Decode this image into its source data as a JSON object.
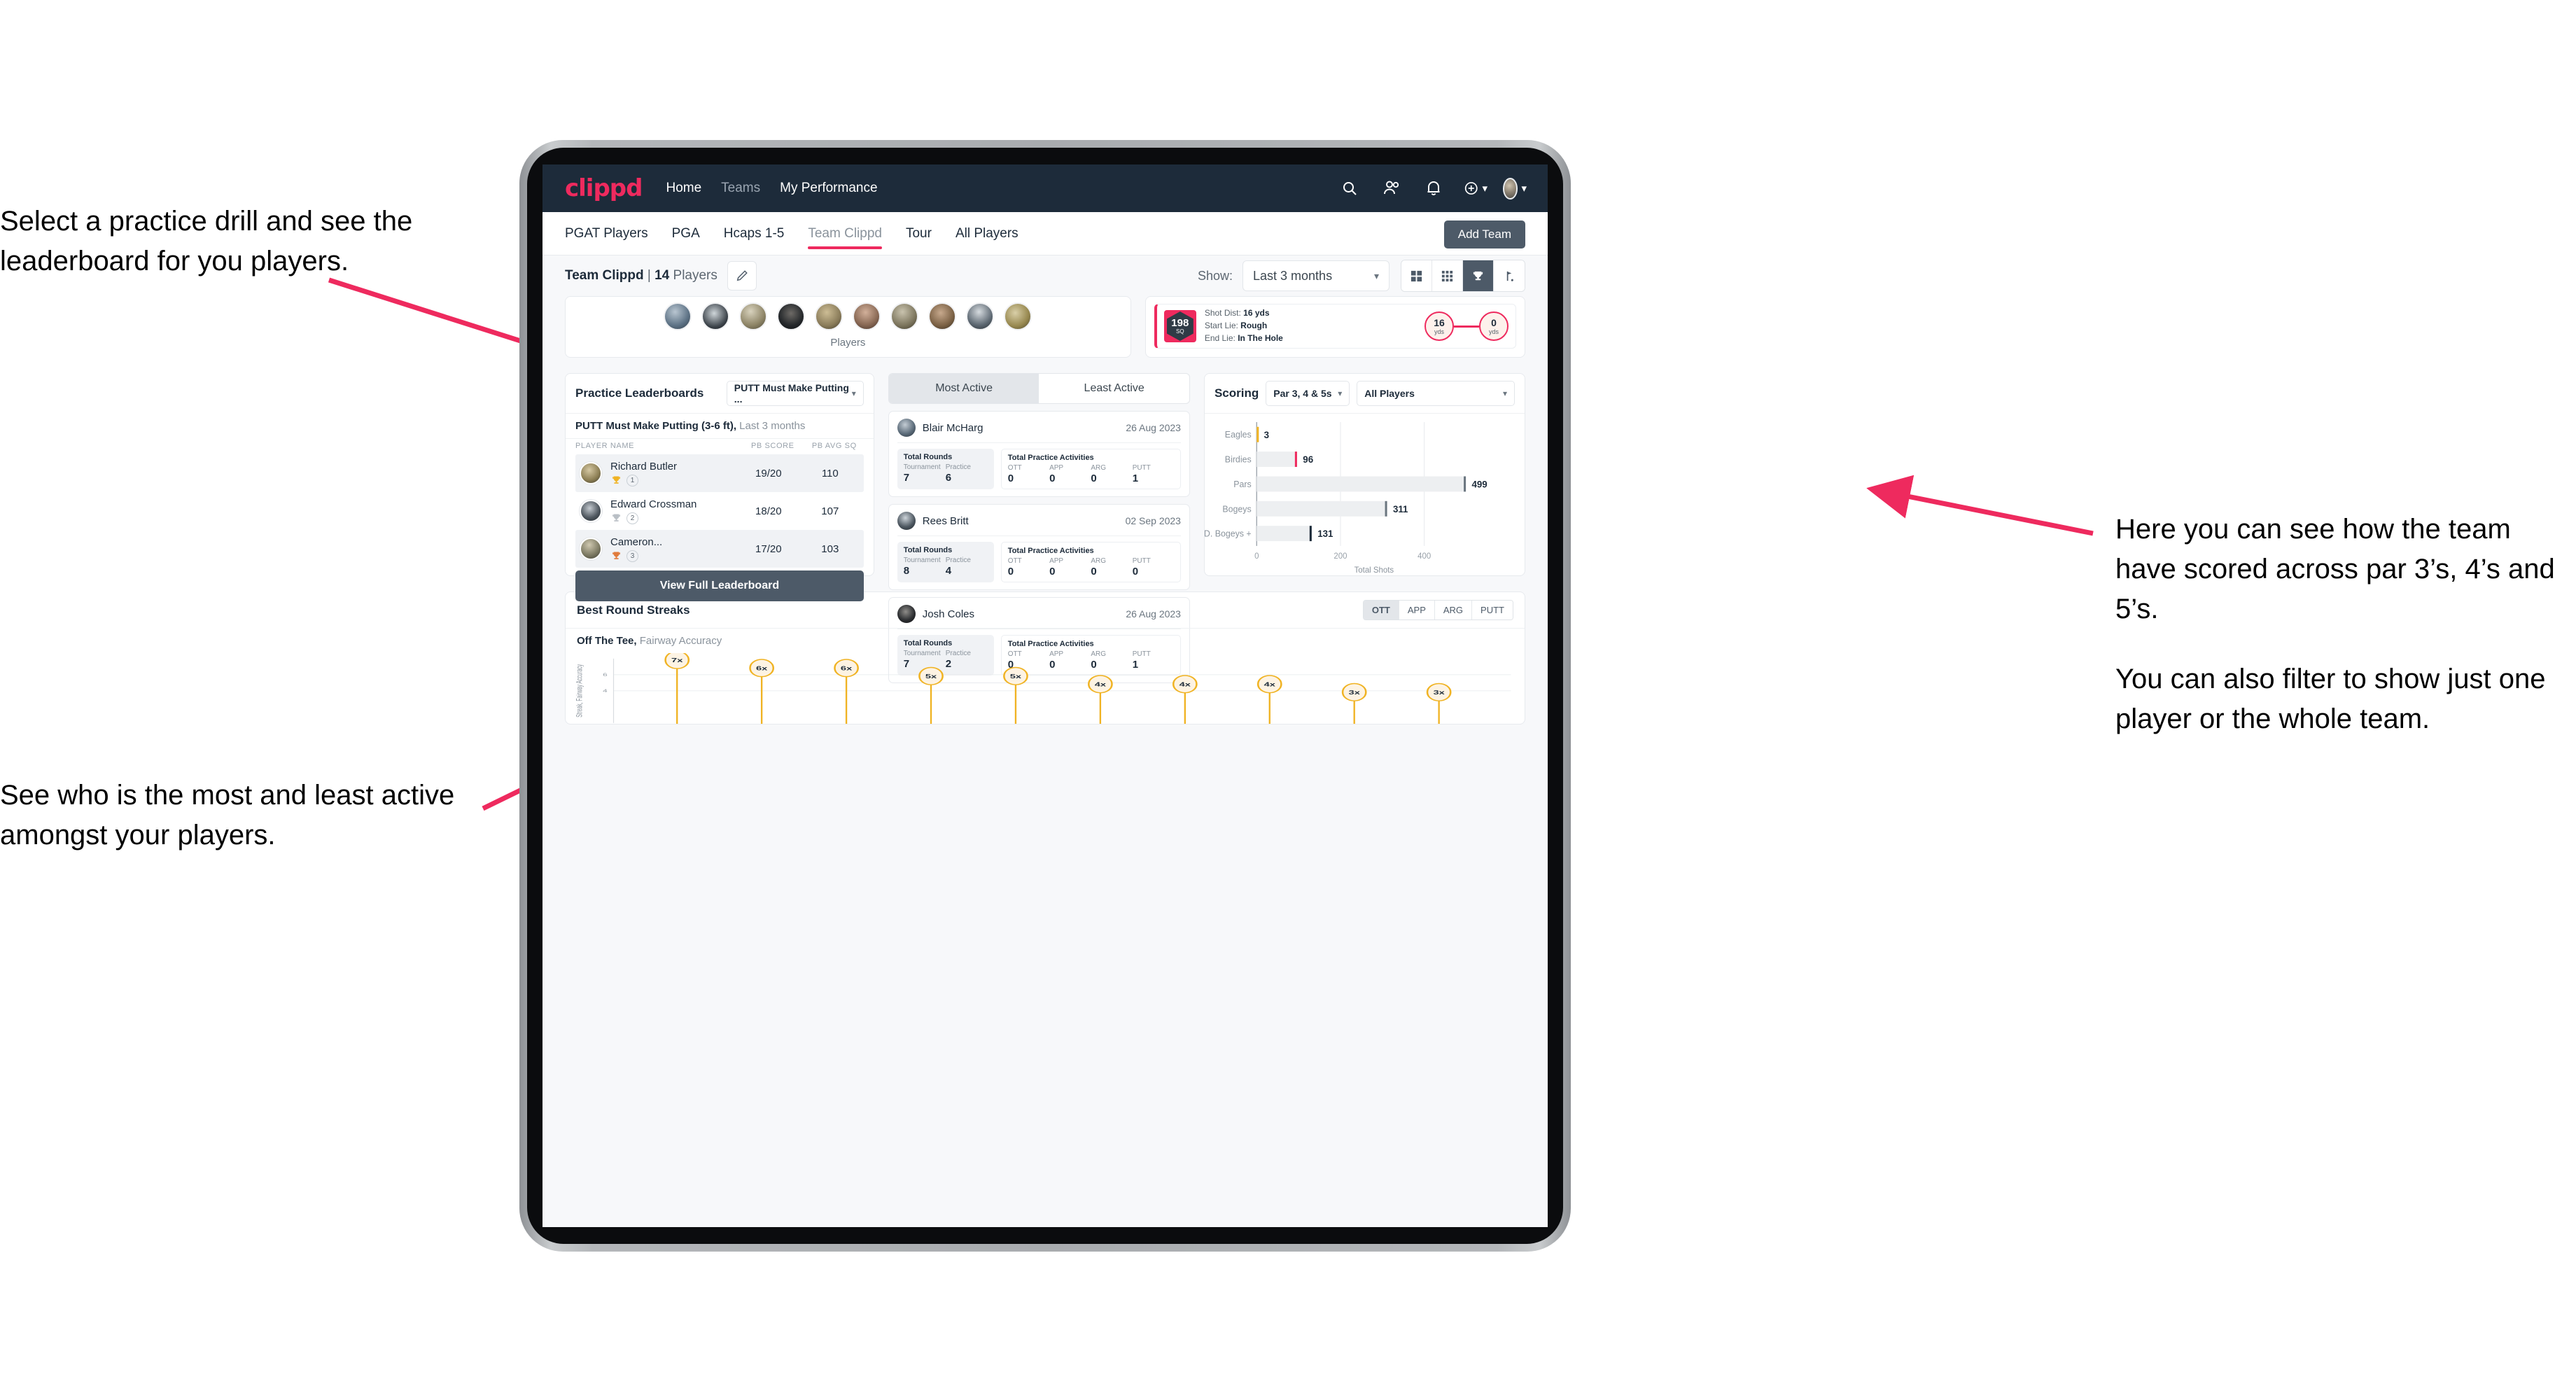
{
  "annotations": {
    "top_left": "Select a practice drill and see the leaderboard for you players.",
    "bottom_left": "See who is the most and least active amongst your players.",
    "right_1": "Here you can see how the team have scored across par 3’s, 4’s and 5’s.",
    "right_2": "You can also filter to show just one player or the whole team."
  },
  "app": {
    "logo": "clippd",
    "nav": [
      {
        "label": "Home",
        "dim": false
      },
      {
        "label": "Teams",
        "dim": true
      },
      {
        "label": "My Performance",
        "dim": false
      }
    ],
    "icons": [
      "search-icon",
      "people-icon",
      "bell-icon",
      "plus-circle-icon",
      "avatar"
    ]
  },
  "tabs": {
    "items": [
      {
        "label": "PGAT Players",
        "active": false,
        "muted": false
      },
      {
        "label": "PGA",
        "active": false,
        "muted": false
      },
      {
        "label": "Hcaps 1-5",
        "active": false,
        "muted": false
      },
      {
        "label": "Team Clippd",
        "active": true,
        "muted": true
      },
      {
        "label": "Tour",
        "active": false,
        "muted": false
      },
      {
        "label": "All Players",
        "active": false,
        "muted": false
      }
    ],
    "add_team_label": "Add Team"
  },
  "toolbar": {
    "team_name": "Team Clippd",
    "team_separator": " | ",
    "player_count": "14",
    "players_word": " Players",
    "edit_icon": "pencil-icon",
    "show_label": "Show:",
    "show_value": "Last 3 months",
    "view_modes": [
      {
        "name": "grid-view-icon",
        "on": false
      },
      {
        "name": "dots-grid-view-icon",
        "on": false
      },
      {
        "name": "trophy-view-icon",
        "on": true
      },
      {
        "name": "golf-flag-view-icon",
        "on": false
      }
    ]
  },
  "players_card": {
    "caption": "Players",
    "avatar_count": 10
  },
  "shot_card": {
    "badge_number": "198",
    "badge_unit": "SQ",
    "lines": [
      {
        "key": "Shot Dist: ",
        "value": "16 yds"
      },
      {
        "key": "Start Lie: ",
        "value": "Rough"
      },
      {
        "key": "End Lie: ",
        "value": "In The Hole"
      }
    ],
    "start_value": "16",
    "start_unit": "yds",
    "end_value": "0",
    "end_unit": "yds"
  },
  "leaderboard": {
    "title": "Practice Leaderboards",
    "drill_select": "PUTT Must Make Putting ...",
    "subtitle_bold": "PUTT Must Make Putting (3-6 ft),",
    "subtitle_rest": " Last 3 months",
    "columns": [
      "PLAYER NAME",
      "PB SCORE",
      "PB AVG SQ"
    ],
    "rows": [
      {
        "name": "Richard Butler",
        "rank": "1",
        "trophy": "gold",
        "pb_score": "19/20",
        "pb_avg_sq": "110"
      },
      {
        "name": "Edward Crossman",
        "rank": "2",
        "trophy": "silver",
        "pb_score": "18/20",
        "pb_avg_sq": "107"
      },
      {
        "name": "Cameron...",
        "rank": "3",
        "trophy": "bronze",
        "pb_score": "17/20",
        "pb_avg_sq": "103"
      }
    ],
    "view_full_label": "View Full Leaderboard"
  },
  "activity": {
    "tabs": [
      {
        "label": "Most Active",
        "on": true
      },
      {
        "label": "Least Active",
        "on": false
      }
    ],
    "rounds_title": "Total Rounds",
    "acts_title": "Total Practice Activities",
    "rounds_keys": [
      "Tournament",
      "Practice"
    ],
    "acts_keys": [
      "OTT",
      "APP",
      "ARG",
      "PUTT"
    ],
    "cards": [
      {
        "name": "Blair McHarg",
        "date": "26 Aug 2023",
        "tournament": "7",
        "practice": "6",
        "ott": "0",
        "app": "0",
        "arg": "0",
        "putt": "1"
      },
      {
        "name": "Rees Britt",
        "date": "02 Sep 2023",
        "tournament": "8",
        "practice": "4",
        "ott": "0",
        "app": "0",
        "arg": "0",
        "putt": "0"
      },
      {
        "name": "Josh Coles",
        "date": "26 Aug 2023",
        "tournament": "7",
        "practice": "2",
        "ott": "0",
        "app": "0",
        "arg": "0",
        "putt": "1"
      }
    ]
  },
  "scoring": {
    "title": "Scoring",
    "par_select": "Par 3, 4 & 5s",
    "player_select": "All Players"
  },
  "streaks": {
    "title": "Best Round Streaks",
    "toggle": [
      {
        "label": "OTT",
        "on": true
      },
      {
        "label": "APP",
        "on": false
      },
      {
        "label": "ARG",
        "on": false
      },
      {
        "label": "PUTT",
        "on": false
      }
    ],
    "sub_bold": "Off The Tee,",
    "sub_rest": " Fairway Accuracy"
  },
  "chart_data": [
    {
      "type": "bar",
      "orientation": "horizontal",
      "title": "Scoring",
      "categories": [
        "Eagles",
        "Birdies",
        "Pars",
        "Bogeys",
        "D. Bogeys +"
      ],
      "values": [
        3,
        96,
        499,
        311,
        131
      ],
      "bar_colors": [
        "#f0b323",
        "#ee2a5e",
        "#6b7680",
        "#6b7680",
        "#1d2b3a"
      ],
      "xlabel": "Total Shots",
      "ylabel": "",
      "xlim": [
        0,
        560
      ],
      "xticks": [
        0,
        200,
        400
      ],
      "grid": true,
      "legend": "none"
    },
    {
      "type": "scatter",
      "title": "Best Round Streaks",
      "subtitle": "Off The Tee, Fairway Accuracy",
      "ylabel": "Streak, Fairway Accuracy",
      "xlabel": "",
      "values": [
        7,
        6,
        6,
        5,
        5,
        4,
        4,
        4,
        3,
        3
      ],
      "labels": [
        "7x",
        "6x",
        "6x",
        "5x",
        "5x",
        "4x",
        "4x",
        "4x",
        "3x",
        "3x"
      ],
      "yticks": [
        4,
        6
      ],
      "ylim": [
        0,
        8
      ],
      "marker_color": "#f0b323",
      "marker_fill": "#fdf3e3",
      "grid": true
    }
  ]
}
